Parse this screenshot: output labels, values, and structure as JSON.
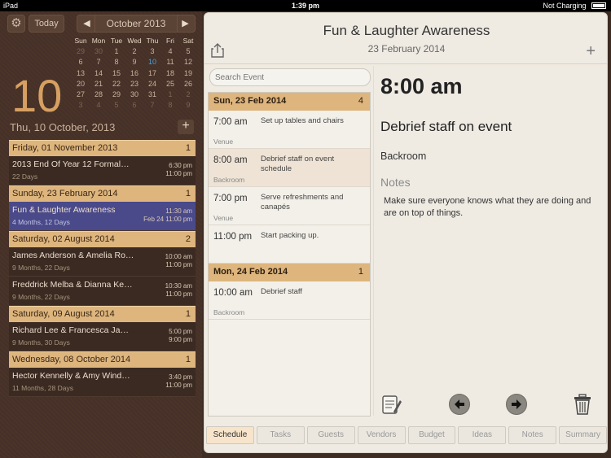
{
  "status": {
    "device": "iPad",
    "time": "1:39 pm",
    "charging": "Not Charging"
  },
  "toolbar": {
    "today": "Today",
    "month": "October 2013",
    "prev": "◀",
    "next": "▶",
    "settings_icon": "gear-icon"
  },
  "calendar": {
    "weekdays": [
      "Sun",
      "Mon",
      "Tue",
      "Wed",
      "Thu",
      "Fri",
      "Sat"
    ],
    "weeks": [
      [
        "29",
        "30",
        "1",
        "2",
        "3",
        "4",
        "5"
      ],
      [
        "6",
        "7",
        "8",
        "9",
        "10",
        "11",
        "12"
      ],
      [
        "13",
        "14",
        "15",
        "16",
        "17",
        "18",
        "19"
      ],
      [
        "20",
        "21",
        "22",
        "23",
        "24",
        "25",
        "26"
      ],
      [
        "27",
        "28",
        "29",
        "30",
        "31",
        "1",
        "2"
      ],
      [
        "3",
        "4",
        "5",
        "6",
        "7",
        "8",
        "9"
      ]
    ]
  },
  "selected": {
    "day_number": "10",
    "date_line": "Thu, 10 October, 2013"
  },
  "events": {
    "sections": [
      {
        "date": "Friday, 01 November 2013",
        "count": "1",
        "items": [
          {
            "title": "2013 End Of Year 12 Formal…",
            "duration": "22 Days",
            "time_start": "6:30 pm",
            "time_end": "11:00 pm"
          }
        ]
      },
      {
        "date": "Sunday, 23 February 2014",
        "count": "1",
        "items": [
          {
            "title": "Fun & Laughter Awareness",
            "duration": "4 Months, 12 Days",
            "time_start": "11:30 am",
            "time_end": "Feb 24  11:00 pm"
          }
        ]
      },
      {
        "date": "Saturday, 02 August 2014",
        "count": "2",
        "items": [
          {
            "title": "James Anderson & Amelia Ro…",
            "duration": "9 Months, 22 Days",
            "time_start": "10:00 am",
            "time_end": "11:00 pm"
          },
          {
            "title": "Freddrick Melba & Dianna Ke…",
            "duration": "9 Months, 22 Days",
            "time_start": "10:30 am",
            "time_end": "11:00 pm"
          }
        ]
      },
      {
        "date": "Saturday, 09 August 2014",
        "count": "1",
        "items": [
          {
            "title": "Richard Lee & Francesca Ja…",
            "duration": "9 Months, 30 Days",
            "time_start": "5:00 pm",
            "time_end": "9:00 pm"
          }
        ]
      },
      {
        "date": "Wednesday, 08 October 2014",
        "count": "1",
        "items": [
          {
            "title": "Hector Kennelly & Amy Wind…",
            "duration": "11 Months, 28 Days",
            "time_start": "3:40 pm",
            "time_end": "11:00 pm"
          }
        ]
      }
    ]
  },
  "detail": {
    "title": "Fun & Laughter Awareness",
    "date": "23 February 2014",
    "search_placeholder": "Search Event",
    "time": "8:00 am",
    "event_title": "Debrief staff on event",
    "location": "Backroom",
    "notes_label": "Notes",
    "notes": "Make sure everyone knows what they are doing and are on top of things."
  },
  "schedule": {
    "days": [
      {
        "date": "Sun, 23 Feb 2014",
        "count": "4",
        "items": [
          {
            "time": "7:00 am",
            "desc": "Set up tables and chairs",
            "loc": "Venue"
          },
          {
            "time": "8:00 am",
            "desc": "Debrief staff on event schedule",
            "loc": "Backroom"
          },
          {
            "time": "7:00 pm",
            "desc": "Serve refreshments and canapés",
            "loc": "Venue"
          },
          {
            "time": "11:00 pm",
            "desc": "Start packing up.",
            "loc": ""
          }
        ]
      },
      {
        "date": "Mon, 24 Feb 2014",
        "count": "1",
        "items": [
          {
            "time": "10:00 am",
            "desc": "Debrief staff",
            "loc": "Backroom"
          }
        ]
      }
    ]
  },
  "tabs": [
    "Schedule",
    "Tasks",
    "Guests",
    "Vendors",
    "Budget",
    "Ideas",
    "Notes",
    "Summary"
  ]
}
